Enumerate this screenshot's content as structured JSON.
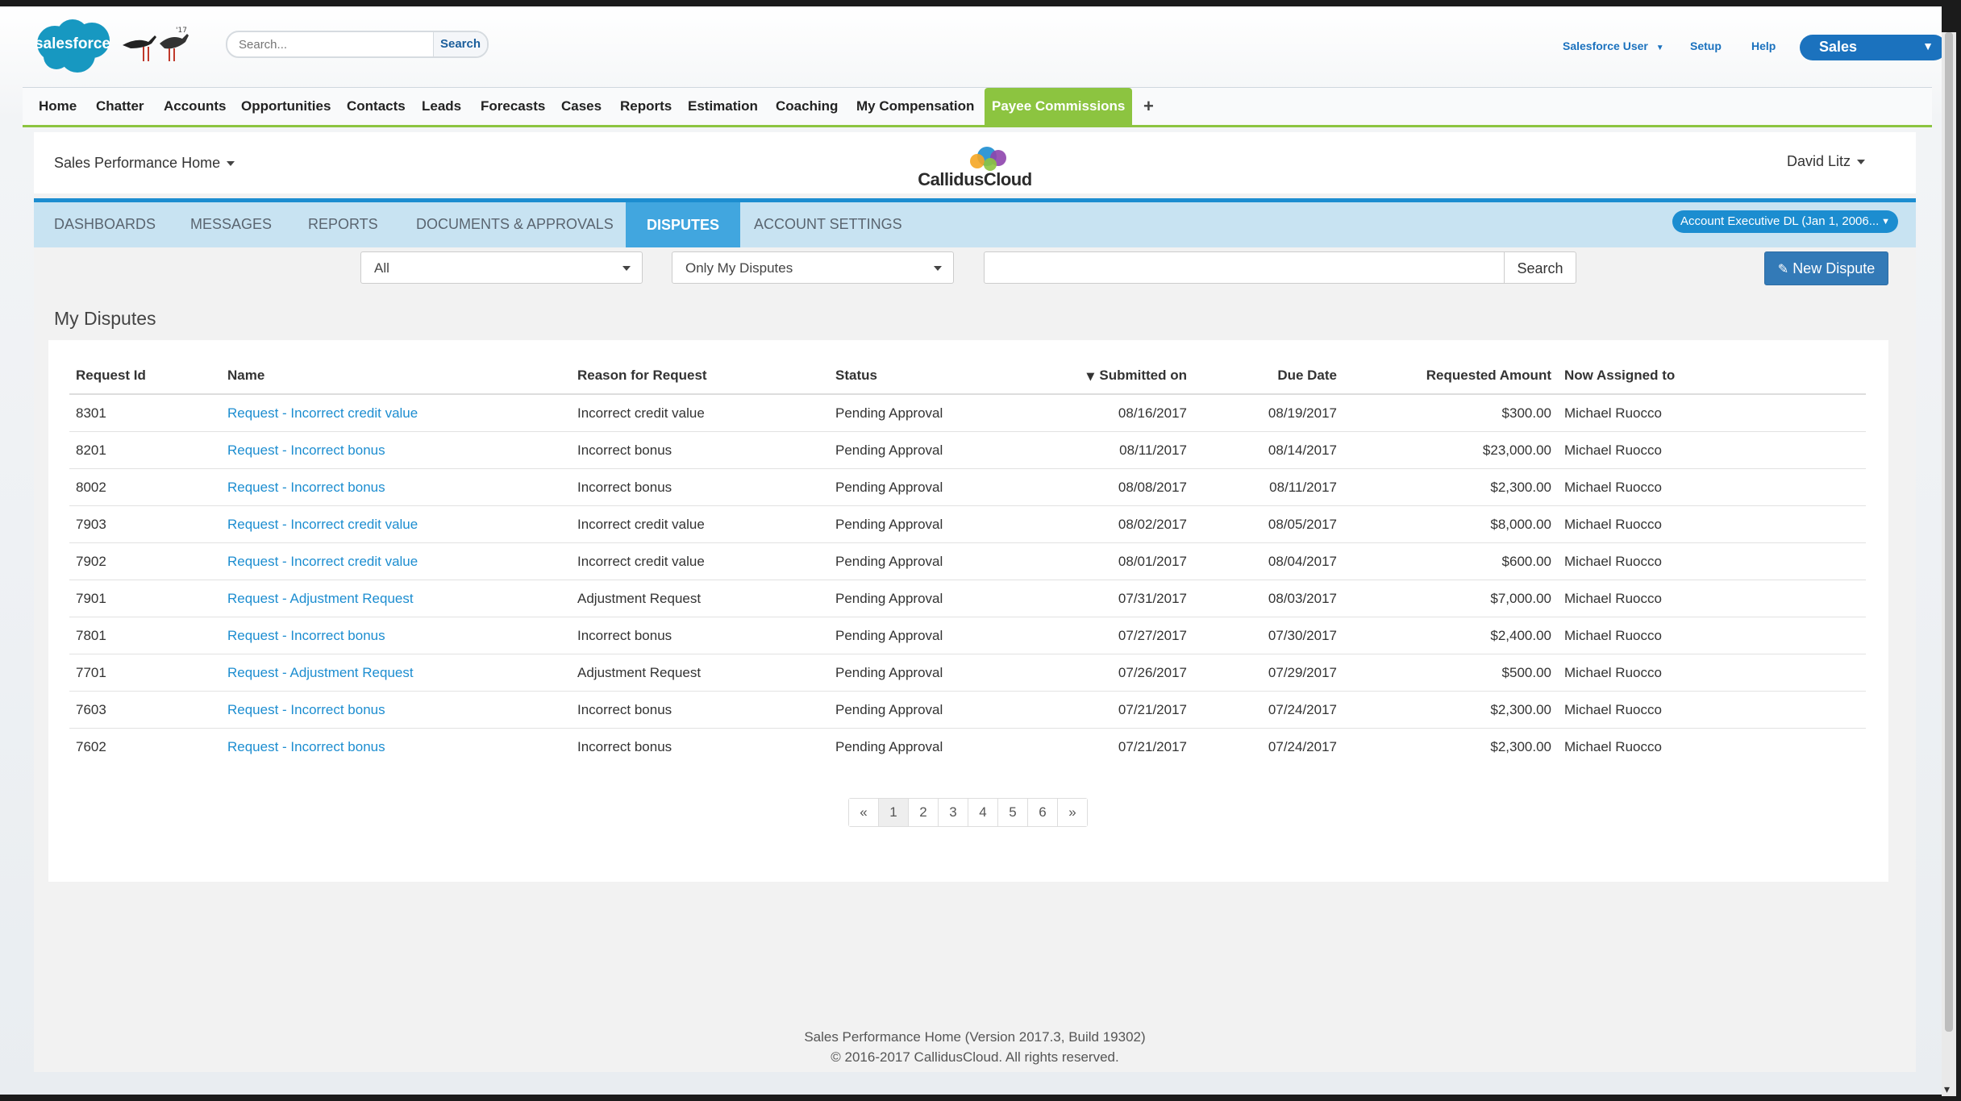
{
  "salesforce": {
    "logo_text": "salesforce",
    "search_placeholder": "Search...",
    "search_button": "Search",
    "user_menu": "Salesforce User",
    "setup": "Setup",
    "help": "Help",
    "app_switcher": "Sales"
  },
  "tabs": [
    "Home",
    "Chatter",
    "Accounts",
    "Opportunities",
    "Contacts",
    "Leads",
    "Forecasts",
    "Cases",
    "Reports",
    "Estimation",
    "Coaching",
    "My Compensation",
    "Payee Commissions"
  ],
  "active_tab": "Payee Commissions",
  "callidus": {
    "home_menu": "Sales Performance Home",
    "logo_text": "CallidusCloud",
    "user": "David Litz",
    "subnav": [
      "DASHBOARDS",
      "MESSAGES",
      "REPORTS",
      "DOCUMENTS & APPROVALS",
      "DISPUTES",
      "ACCOUNT SETTINGS"
    ],
    "active_subnav": "DISPUTES",
    "account_select": "Account Executive DL (Jan 1, 2006..."
  },
  "filters": {
    "scope": "All",
    "ownership": "Only My Disputes",
    "search_value": "",
    "search_button": "Search",
    "new_button": "New Dispute"
  },
  "section_title": "My Disputes",
  "table": {
    "columns": [
      "Request Id",
      "Name",
      "Reason for Request",
      "Status",
      "Submitted on",
      "Due Date",
      "Requested Amount",
      "Now Assigned to"
    ],
    "rows": [
      [
        "8301",
        "Request - Incorrect credit value",
        "Incorrect credit value",
        "Pending Approval",
        "08/16/2017",
        "08/19/2017",
        "$300.00",
        "Michael Ruocco"
      ],
      [
        "8201",
        "Request - Incorrect bonus",
        "Incorrect bonus",
        "Pending Approval",
        "08/11/2017",
        "08/14/2017",
        "$23,000.00",
        "Michael Ruocco"
      ],
      [
        "8002",
        "Request - Incorrect bonus",
        "Incorrect bonus",
        "Pending Approval",
        "08/08/2017",
        "08/11/2017",
        "$2,300.00",
        "Michael Ruocco"
      ],
      [
        "7903",
        "Request - Incorrect credit value",
        "Incorrect credit value",
        "Pending Approval",
        "08/02/2017",
        "08/05/2017",
        "$8,000.00",
        "Michael Ruocco"
      ],
      [
        "7902",
        "Request - Incorrect credit value",
        "Incorrect credit value",
        "Pending Approval",
        "08/01/2017",
        "08/04/2017",
        "$600.00",
        "Michael Ruocco"
      ],
      [
        "7901",
        "Request - Adjustment Request",
        "Adjustment Request",
        "Pending Approval",
        "07/31/2017",
        "08/03/2017",
        "$7,000.00",
        "Michael Ruocco"
      ],
      [
        "7801",
        "Request - Incorrect bonus",
        "Incorrect bonus",
        "Pending Approval",
        "07/27/2017",
        "07/30/2017",
        "$2,400.00",
        "Michael Ruocco"
      ],
      [
        "7701",
        "Request - Adjustment Request",
        "Adjustment Request",
        "Pending Approval",
        "07/26/2017",
        "07/29/2017",
        "$500.00",
        "Michael Ruocco"
      ],
      [
        "7603",
        "Request - Incorrect bonus",
        "Incorrect bonus",
        "Pending Approval",
        "07/21/2017",
        "07/24/2017",
        "$2,300.00",
        "Michael Ruocco"
      ],
      [
        "7602",
        "Request - Incorrect bonus",
        "Incorrect bonus",
        "Pending Approval",
        "07/21/2017",
        "07/24/2017",
        "$2,300.00",
        "Michael Ruocco"
      ]
    ]
  },
  "pagination": {
    "prev": "«",
    "pages": [
      "1",
      "2",
      "3",
      "4",
      "5",
      "6"
    ],
    "current": "1",
    "next": "»"
  },
  "footer": {
    "version": "Sales Performance Home (Version 2017.3, Build 19302)",
    "copyright": "© 2016-2017 CallidusCloud. All rights reserved."
  },
  "colors": {
    "salesforce_blue": "#1b72be",
    "tab_green": "#8cc440",
    "callidus_blue": "#1c8dd0",
    "link": "#1c8dd0",
    "new_button": "#337ab7"
  }
}
